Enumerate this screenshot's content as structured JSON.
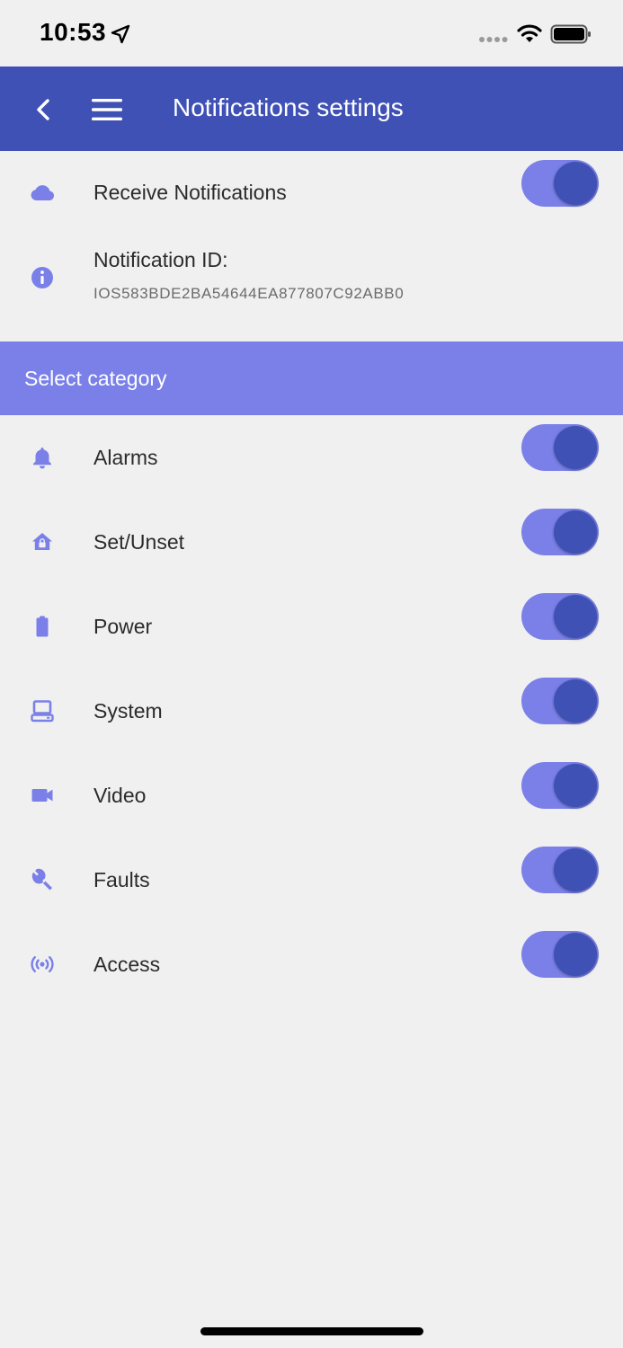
{
  "status_bar": {
    "time": "10:53"
  },
  "header": {
    "title": "Notifications settings"
  },
  "colors": {
    "primary": "#3f51b5",
    "accent": "#7a80e8",
    "background": "#f0f0f0"
  },
  "receive": {
    "label": "Receive Notifications",
    "enabled": true
  },
  "notification_id": {
    "label": "Notification ID:",
    "value": "IOS583BDE2BA54644EA877807C92ABB0"
  },
  "section": {
    "title": "Select category"
  },
  "categories": [
    {
      "label": "Alarms",
      "icon": "bell-icon",
      "enabled": true
    },
    {
      "label": "Set/Unset",
      "icon": "home-lock-icon",
      "enabled": true
    },
    {
      "label": "Power",
      "icon": "battery-icon",
      "enabled": true
    },
    {
      "label": "System",
      "icon": "computer-icon",
      "enabled": true
    },
    {
      "label": "Video",
      "icon": "video-camera-icon",
      "enabled": true
    },
    {
      "label": "Faults",
      "icon": "wrench-icon",
      "enabled": true
    },
    {
      "label": "Access",
      "icon": "broadcast-icon",
      "enabled": true
    }
  ]
}
